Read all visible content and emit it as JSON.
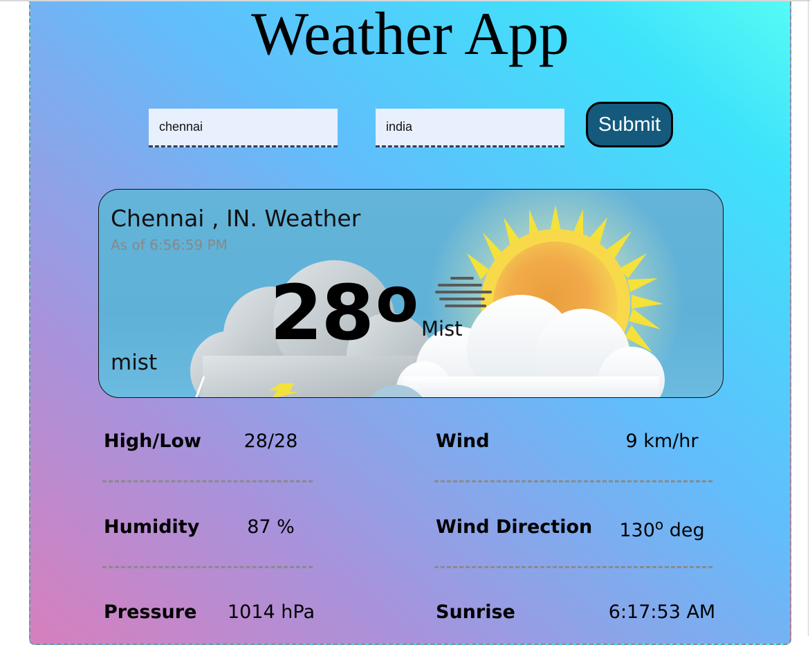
{
  "app": {
    "title": "Weather App"
  },
  "search": {
    "city_value": "chennai",
    "country_value": "india",
    "submit_label": "Submit"
  },
  "current": {
    "location": "Chennai , IN. Weather",
    "as_of": "As of 6:56:59 PM",
    "temperature": "28",
    "degree_symbol": "o",
    "condition": "Mist",
    "description": "mist"
  },
  "stats": {
    "high_low": {
      "label": "High/Low",
      "value": "28/28"
    },
    "humidity": {
      "label": "Humidity",
      "value": "87 %"
    },
    "pressure": {
      "label": "Pressure",
      "value": "1014 hPa"
    },
    "wind": {
      "label": "Wind",
      "value": "9 km/hr"
    },
    "wind_direction": {
      "label": "Wind Direction",
      "value": "130",
      "degree_symbol": "o",
      "unit": " deg"
    },
    "sunrise": {
      "label": "Sunrise",
      "value": "6:17:53 AM"
    }
  },
  "colors": {
    "submit_bg": "#155a7d",
    "input_bg": "#e8f0fe",
    "card_bg": "#64b4d9",
    "timestamp": "#888886"
  },
  "icons": {
    "weather_illustration": "sun-cloud-mist-illustration"
  }
}
